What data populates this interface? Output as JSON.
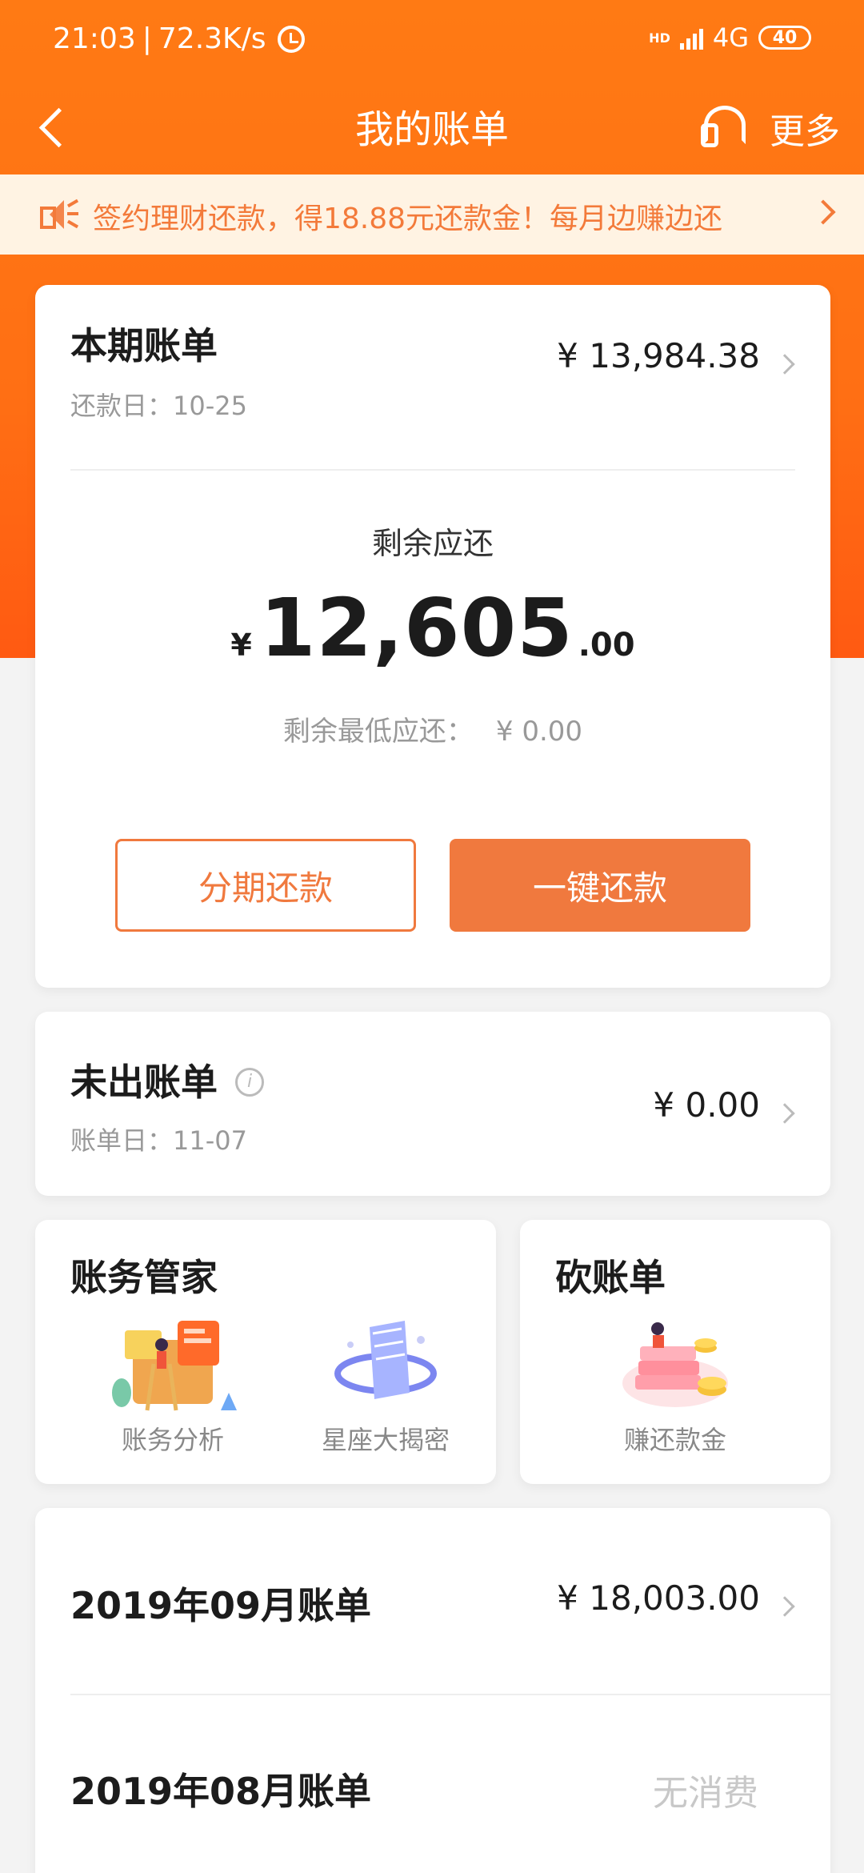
{
  "status_bar": {
    "time": "21:03",
    "speed": "72.3K/s",
    "network": "4G",
    "hd": "HD",
    "battery": "40"
  },
  "nav": {
    "title": "我的账单",
    "more": "更多"
  },
  "notice": {
    "text": "签约理财还款，得18.88元还款金！每月边赚边还"
  },
  "current_bill": {
    "title": "本期账单",
    "due_date": "还款日：10-25",
    "amount": "¥ 13,984.38",
    "remaining_label": "剩余应还",
    "remaining_symbol": "¥",
    "remaining_integer": "12,605",
    "remaining_decimal": ".00",
    "min_due_label": "剩余最低应还：",
    "min_due_value": "¥ 0.00",
    "installment_button": "分期还款",
    "pay_button": "一键还款"
  },
  "unbilled": {
    "title": "未出账单",
    "bill_date": "账单日：11-07",
    "amount": "¥ 0.00",
    "info_icon": "i"
  },
  "manager": {
    "title": "账务管家",
    "tools": [
      {
        "label": "账务分析",
        "icon": "analysis-illustration"
      },
      {
        "label": "星座大揭密",
        "icon": "horoscope-illustration"
      }
    ]
  },
  "cut_bill": {
    "title": "砍账单",
    "tool": {
      "label": "赚还款金",
      "icon": "earn-coins-illustration"
    }
  },
  "history": [
    {
      "title": "2019年09月账单",
      "amount": "¥ 18,003.00"
    },
    {
      "title": "2019年08月账单",
      "amount": "无消费"
    }
  ],
  "colors": {
    "brand_orange": "#ff7a14",
    "button_orange": "#f0793e",
    "notice_bg": "#fff3e3"
  }
}
